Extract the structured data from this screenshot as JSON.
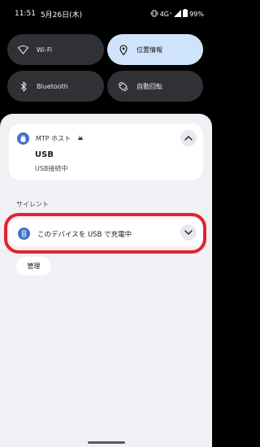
{
  "status_bar": {
    "time": "11:51",
    "date": "5月26日(木)",
    "network": "4G⁺",
    "battery": "99%"
  },
  "quick_settings": {
    "tiles": [
      {
        "label": "Wi-Fi",
        "icon": "wifi-icon",
        "active": false
      },
      {
        "label": "位置情報",
        "icon": "location-pin-icon",
        "active": true
      },
      {
        "label": "Bluetooth",
        "icon": "bluetooth-icon",
        "active": false
      },
      {
        "label": "自動回転",
        "icon": "auto-rotate-icon",
        "active": false
      }
    ]
  },
  "notification": {
    "app_name": "MTP ホスト",
    "title": "USB",
    "body": "USB接続中"
  },
  "silent_section": {
    "label": "サイレント",
    "item_text": "このデバイスを USB で充電中"
  },
  "manage_button": {
    "label": "管理"
  },
  "colors": {
    "highlight": "#e0232e",
    "active_tile": "#cfe4fb",
    "app_icon": "#3f6fc9"
  }
}
